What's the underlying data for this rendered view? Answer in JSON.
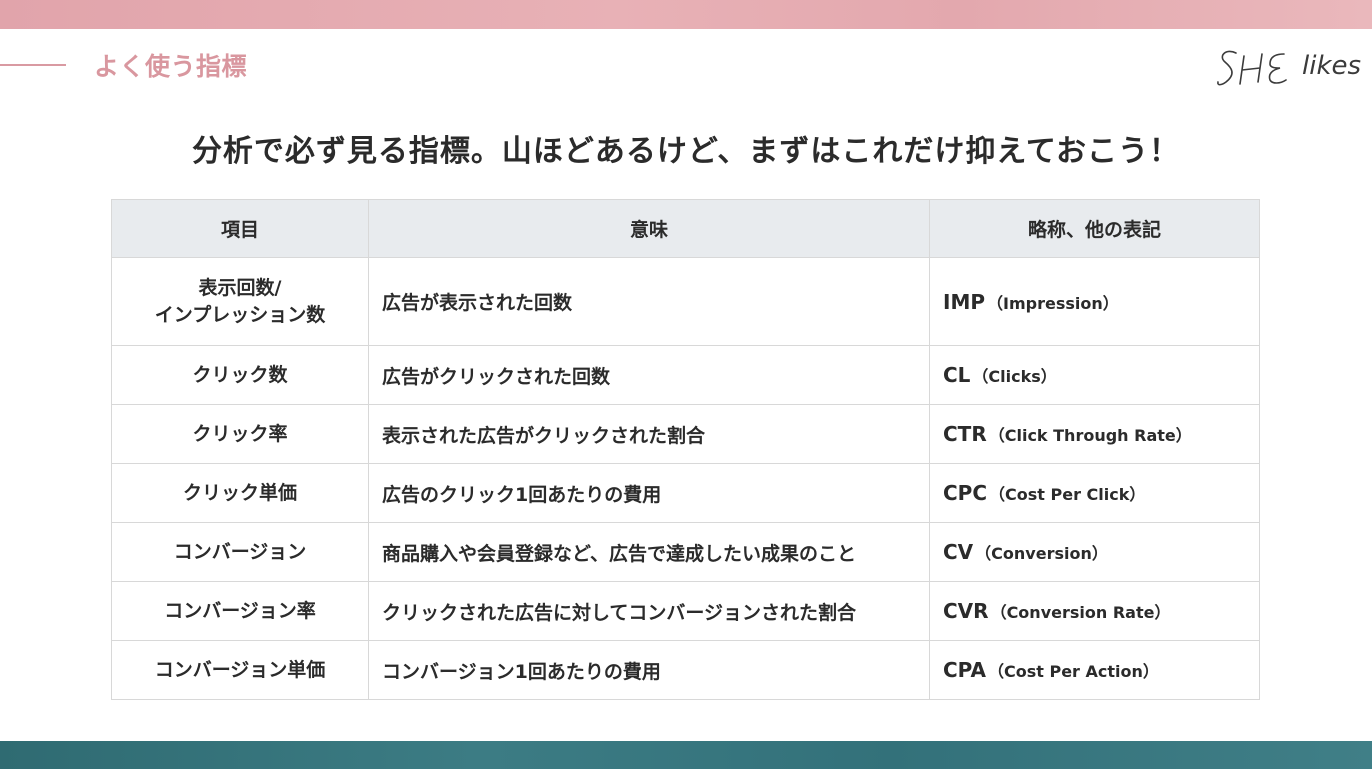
{
  "header": {
    "section_label": "よく使う指標",
    "logo_text": "likes",
    "logo_signature_text": "SHE",
    "band_top_color": "#e5aeb3",
    "band_bottom_color": "#37737b",
    "accent_color": "#d9979f"
  },
  "headline": "分析で必ず見る指標。山ほどあるけど、まずはこれだけ抑えておこう！",
  "table": {
    "columns": [
      "項目",
      "意味",
      "略称、他の表記"
    ],
    "rows": [
      {
        "term_line1": "表示回数/",
        "term_line2": "インプレッション数",
        "meaning": "広告が表示された回数",
        "abbr": "IMP",
        "abbr_full": "（Impression）"
      },
      {
        "term": "クリック数",
        "meaning": "広告がクリックされた回数",
        "abbr": "CL",
        "abbr_full": "（Clicks）"
      },
      {
        "term": "クリック率",
        "meaning": "表示された広告がクリックされた割合",
        "abbr": "CTR",
        "abbr_full": "（Click Through Rate）"
      },
      {
        "term": "クリック単価",
        "meaning": "広告のクリック1回あたりの費用",
        "abbr": "CPC",
        "abbr_full": "（Cost Per Click）"
      },
      {
        "term": "コンバージョン",
        "meaning": "商品購入や会員登録など、広告で達成したい成果のこと",
        "abbr": "CV",
        "abbr_full": "（Conversion）"
      },
      {
        "term": "コンバージョン率",
        "meaning": "クリックされた広告に対してコンバージョンされた割合",
        "abbr": "CVR",
        "abbr_full": "（Conversion Rate）"
      },
      {
        "term": "コンバージョン単価",
        "meaning": "コンバージョン1回あたりの費用",
        "abbr": "CPA",
        "abbr_full": "（Cost Per Action）"
      }
    ]
  }
}
